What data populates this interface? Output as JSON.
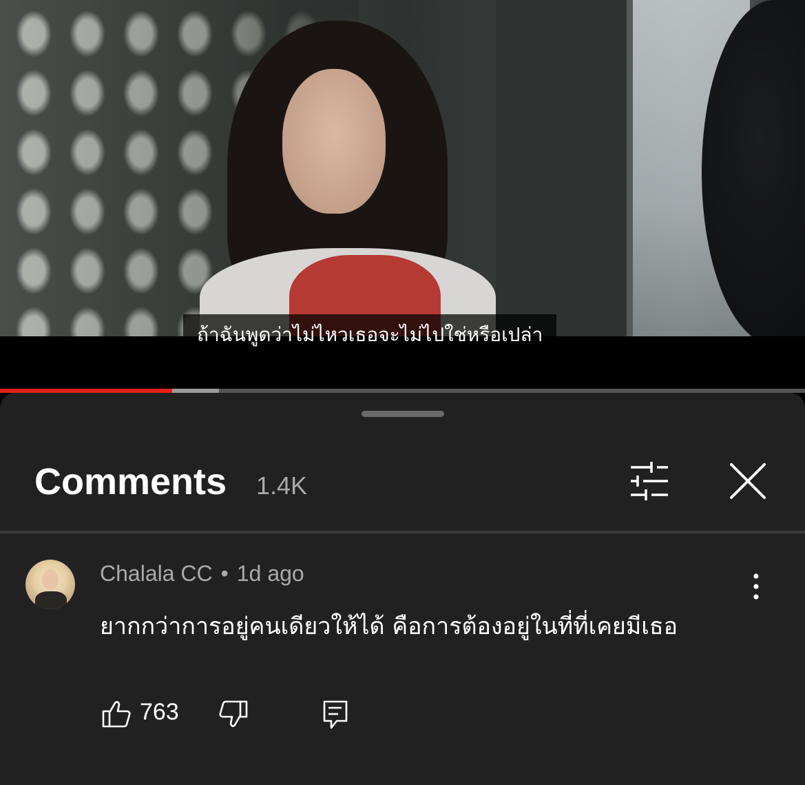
{
  "video": {
    "subtitle": "ถ้าฉันพูดว่าไม่ไหวเธอจะไม่ไปใช่หรือเปล่า",
    "progress_fraction": 0.214,
    "buffered_fraction": 0.272,
    "progress_color": "#e62117"
  },
  "comments_panel": {
    "title": "Comments",
    "count": "1.4K",
    "filter_icon": "sliders-icon",
    "close_icon": "close-icon"
  },
  "comment": {
    "author": "Chalala CC",
    "separator": "•",
    "time": "1d ago",
    "text": "ยากกว่าการอยู่คนเดียวให้ได้ คือการต้องอยู่ในที่ที่เคยมีเธอ",
    "likes": "763",
    "like_icon": "thumbs-up-icon",
    "dislike_icon": "thumbs-down-icon",
    "reply_icon": "reply-icon",
    "more_icon": "more-vert-icon"
  },
  "colors": {
    "sheet_bg": "#212121",
    "text_primary": "#ffffff",
    "text_secondary": "#aaaaaa"
  }
}
